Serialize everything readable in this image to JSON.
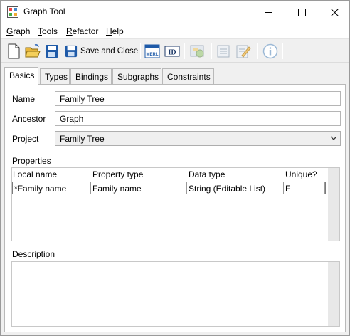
{
  "window": {
    "title": "Graph Tool"
  },
  "menu": {
    "graph": {
      "underline": "G",
      "rest": "raph"
    },
    "tools": {
      "underline": "T",
      "rest": "ools"
    },
    "refactor": {
      "underline": "R",
      "rest": "efactor"
    },
    "help": {
      "underline": "H",
      "rest": "elp"
    }
  },
  "toolbar": {
    "save_and_close_label": "Save and Close",
    "merl_icon_text": "MERL",
    "id_icon_text": "ID"
  },
  "tabs": [
    "Basics",
    "Types",
    "Bindings",
    "Subgraphs",
    "Constraints"
  ],
  "form": {
    "name_label": "Name",
    "name_value": "Family Tree",
    "ancestor_label": "Ancestor",
    "ancestor_value": "Graph",
    "project_label": "Project",
    "project_value": "Family Tree"
  },
  "properties": {
    "label": "Properties",
    "columns": [
      "Local name",
      "Property type",
      "Data type",
      "Unique?"
    ],
    "rows": [
      [
        "*Family name",
        "Family name",
        "String (Editable List)",
        "F"
      ]
    ]
  },
  "description": {
    "label": "Description"
  },
  "colors": {
    "accent": "#1e5aa8",
    "disabled": "#9cb9d6"
  }
}
